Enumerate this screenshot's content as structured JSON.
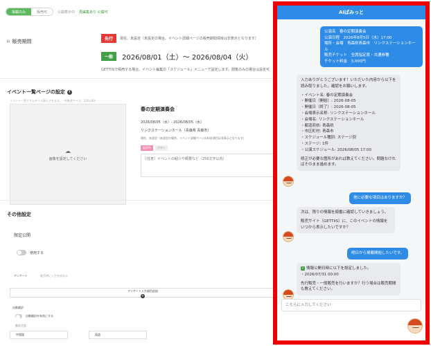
{
  "editor": {
    "mode_toggle": {
      "active": "掲載のみ",
      "inactive": "販売可"
    },
    "top_note": "公開表示中",
    "top_status": "再編集あり 公開可",
    "sale_period": {
      "label": "販売期間",
      "advance_tag": "先行",
      "advance_note": "現在、未設定（未設定の場合、イベント詳細ページの販売期間項目は非表示となります）",
      "general_tag": "一般",
      "general_dates": "2026/08/01（土）〜 2026/08/04（火）",
      "general_note": "GETTIISで販売する場合、イベント編集の「スケジュール」メニューで設定します。閲覧のみの場合は設定可"
    },
    "list_settings": {
      "title": "イベント一覧ページの設定",
      "hint": "イベント一覧でサムネイル表示されます。（※推奨サイズ：320×80）",
      "image_label": "画像を設定してください",
      "card_title": "春の定期演奏会",
      "card_dates": "2026/08/05（水）- 2026/08/05（水）",
      "card_venue": "リンクステーションホール（青森県 青森市）",
      "card_note": "現在、未設定（未設定の場合、イベント詳細ページの料金項目は非表示となります）",
      "tag_pink": "販売中",
      "tag_grey": "ボタン",
      "textarea_placeholder": "［任意］イベントの紹介や概要など（256文字以内）"
    },
    "other_settings": {
      "title": "その他設定",
      "limited_public": "限定公開",
      "use_label": "使用する",
      "questionnaire_label": "アンケート",
      "questionnaire_hint": "販売時に入力を求める",
      "anket_button": "アンケート入力項目追加",
      "auto_translate": "自動翻訳",
      "auto_translate_use": "自動翻訳を有効にする",
      "translate_lang": "翻訳言語",
      "lang_1": "中国語",
      "lang_2": "英語"
    }
  },
  "chat": {
    "title": "AIぱみっと",
    "user_msg_1": [
      "公演名　春の定期演奏会",
      "公演日程　2026年8月5日（水）17:00",
      "場所・会場　青森県青森市　リンクステーションホール",
      "販売チケット　全席指定席・共通券種",
      "チケット料金　3,000円"
    ],
    "bot_msg_1": [
      "入力ありがとうございます！いただいた内容から以下を読み取りました。確認をお願いします。",
      "・イベント名: 春の定期演奏会",
      "・開催日（開始）: 2026-08-05",
      "・開催日（終了）: 2026-08-05",
      "・会場表示名称: リンクステーションホール",
      "・会場名: リンクステーションホール",
      "・都道府県: 青森県",
      "・市区町村: 青森市",
      "・スケジュール種別: ステージ別",
      "・ステージ: 1件",
      "・公演スケジュール: 2026/08/05 17:00",
      "修正が必要な箇所があれば教えてください。問題なければそのまま進めます。"
    ],
    "user_msg_2": "他に必要な項目はありますか？",
    "bot_msg_2": [
      "次は、残りの情報を順番に確認していきましょう。",
      "販売サイト（GETTIIS）に、このイベントの情報をいつから表示したいですか？"
    ],
    "user_msg_3": "明日から掲載開始したいです。",
    "bot_msg_3": [
      "情報公開日時に以下を設定しました。",
      "・2026/07/31 00:00",
      "先行販売・一般販売を行いますか？行う場合は販売期間も教えてください。"
    ],
    "input_placeholder": "こちらに入力してください",
    "avatar_icon": "character-avatar-icon"
  },
  "colors": {
    "accent": "#2e8be6",
    "highlight_border": "#ee0000",
    "active_green": "#5cb85c"
  }
}
